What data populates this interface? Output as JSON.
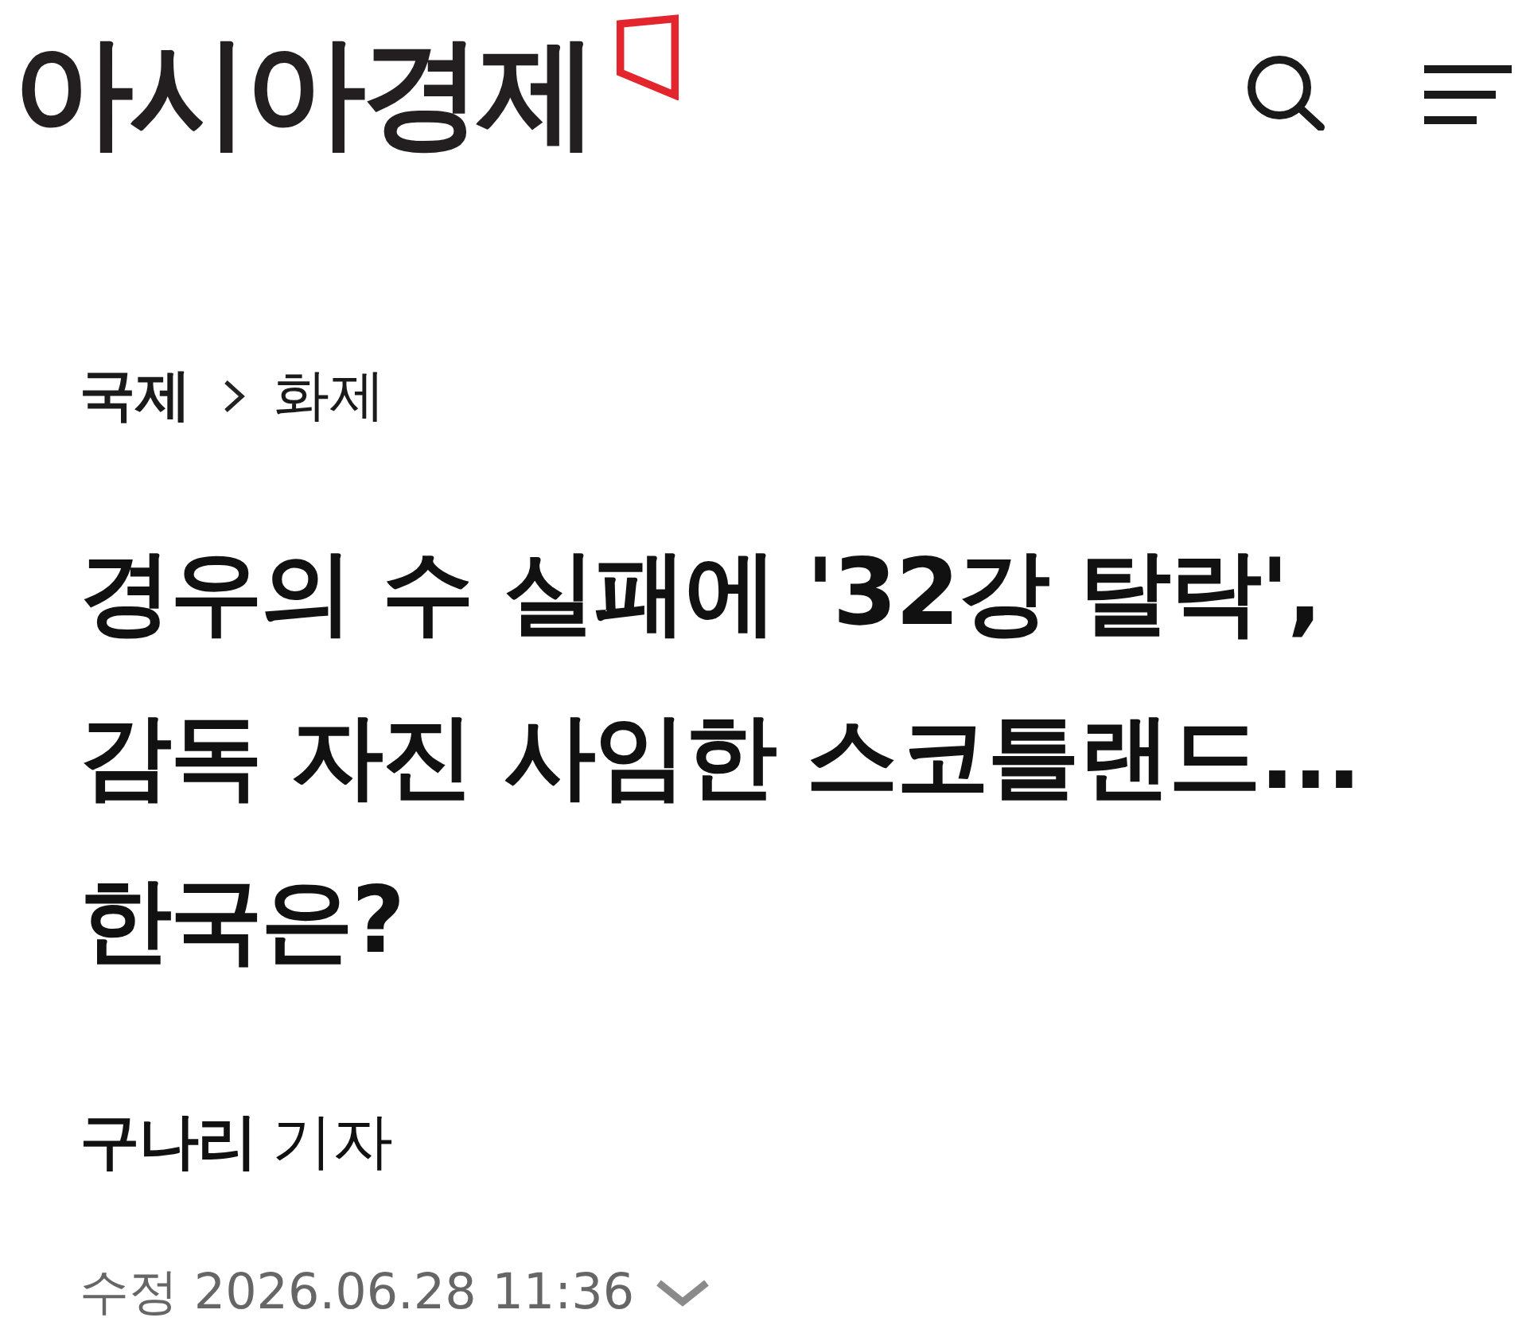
{
  "header": {
    "logo": "아시아경제"
  },
  "breadcrumb": {
    "section": "국제",
    "subsection": "화제"
  },
  "headline": "경우의 수 실패에 '32강 탈락', 감독 자진 사임한 스코틀랜드... 한국은?",
  "byline": {
    "name": "구나리",
    "title": "기자"
  },
  "timestamp": {
    "text": "수정 2026.06.28 11:36",
    "expanded": false
  }
}
